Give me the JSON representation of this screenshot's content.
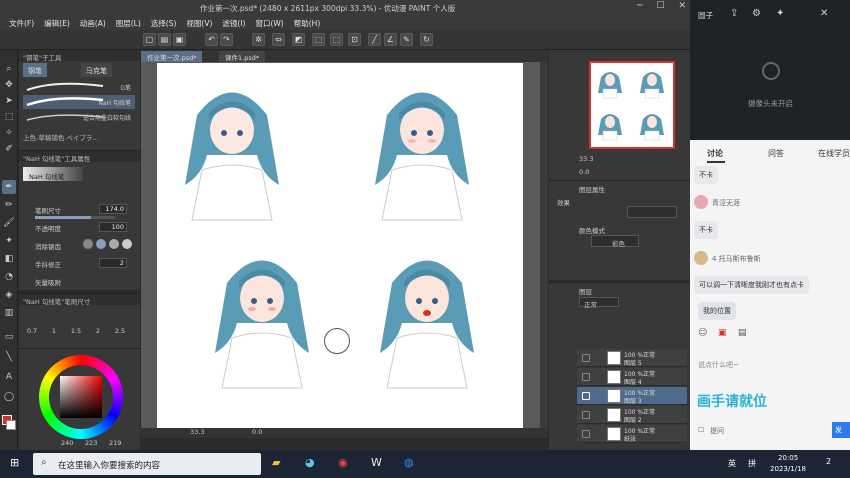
{
  "app": {
    "title": "作业第一次.psd* (2480 x 2611px 300dpi 33.3%)  - 优动漫 PAINT 个人版"
  },
  "menu": [
    "文件(F)",
    "编辑(E)",
    "动画(A)",
    "图层(L)",
    "选择(S)",
    "视图(V)",
    "滤镜(I)",
    "窗口(W)",
    "帮助(H)"
  ],
  "doc_tabs": [
    "作业第一次.psd*",
    "课件1.psd*"
  ],
  "subtool": {
    "header": "\"钢笔\"子工具",
    "tabs": [
      "钢笔",
      "马克笔"
    ],
    "strokes": [
      "G笔",
      "NaH 勾线笔",
      "适合用墨白软勾线",
      "上色-草稿铺色 ペイブラ..."
    ]
  },
  "tool_property": {
    "header": "\"NaH 勾线笔\"工具属性",
    "brush_name": "NaH 勾线笔",
    "rows": [
      {
        "label": "笔刷尺寸",
        "value": "174.0"
      },
      {
        "label": "不透明度",
        "value": "100"
      },
      {
        "label": "消除锯齿",
        "value": ""
      },
      {
        "label": "手抖修正",
        "value": "2"
      },
      {
        "label": "矢量吸附",
        "value": ""
      }
    ]
  },
  "brush_size": {
    "header": "\"NaH 勾线笔\"笔刷尺寸",
    "sizes": [
      "0.7",
      "1",
      "1.5",
      "2",
      "2.5"
    ]
  },
  "color": {
    "r": "240",
    "g": "223",
    "b": "219",
    "main": "#d83020"
  },
  "canvas": {
    "zoom": "33.3",
    "rotation": "0.0"
  },
  "navigator": {
    "zoom": "33.3",
    "rotation": "0.0"
  },
  "layer_property": {
    "header": "图层属性",
    "effect_label": "效果",
    "color_mode_label": "颜色模式",
    "color_mode_value": "彩色"
  },
  "layers": {
    "tab": "图层",
    "blend": "正常",
    "opacity": "100",
    "rows": [
      {
        "l1": "100 %正常",
        "l2": "图层 5"
      },
      {
        "l1": "100 %正常",
        "l2": "图层 4"
      },
      {
        "l1": "100 %正常",
        "l2": "图层 3"
      },
      {
        "l1": "100 %正常",
        "l2": "图层 2"
      },
      {
        "l1": "100 %正常",
        "l2": "纸张"
      }
    ]
  },
  "live": {
    "user": "圆子",
    "camera_off": "摄像头未开启",
    "tabs": [
      "讨论",
      "问答",
      "在线学员"
    ],
    "messages": [
      {
        "type": "bubble",
        "text": "不卡"
      },
      {
        "type": "user",
        "name": "青涩无涯"
      },
      {
        "type": "bubble",
        "text": "不卡"
      },
      {
        "type": "user",
        "name": "4 托马斯布鲁斯"
      },
      {
        "type": "bubble",
        "text": "可以调一下清晰度我刚才也有点卡"
      }
    ],
    "location": "我的位置",
    "input_placeholder": "说点什么吧~",
    "watermark": "画手请就位",
    "ask_label": "提问",
    "send_label": "发"
  },
  "taskbar": {
    "search_placeholder": "在这里输入你要搜索的内容",
    "ime": "英",
    "ime2": "拼",
    "time": "20:05",
    "date": "2023/1/18",
    "notif": "2"
  }
}
